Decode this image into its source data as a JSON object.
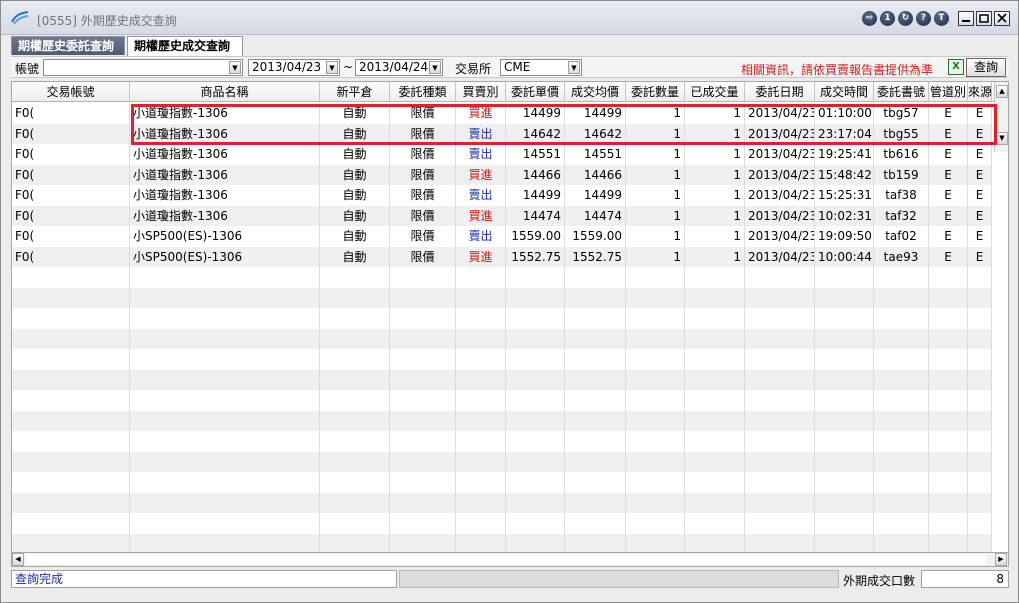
{
  "window": {
    "title": "[0555] 外期歷史成交查詢"
  },
  "titlebar_icons": [
    "export-icon",
    "info-1-icon",
    "refresh-icon",
    "help-icon",
    "t-icon"
  ],
  "tabs": [
    {
      "label": "期權歷史委託查詢",
      "active": false
    },
    {
      "label": "期權歷史成交查詢",
      "active": true
    }
  ],
  "filters": {
    "account_label": "帳號",
    "account_value": "",
    "date_from": "2013/04/23",
    "date_sep": "~",
    "date_to": "2013/04/24",
    "exchange_label": "交易所",
    "exchange_value": "CME",
    "notice": "相關資訊，請依買賣報告書提供為準",
    "excel_icon": "excel-icon",
    "query_label": "查詢"
  },
  "columns": [
    "交易帳號",
    "商品名稱",
    "新平倉",
    "委託種類",
    "買賣別",
    "委託單價",
    "成交均價",
    "委託數量",
    "已成交量",
    "委託日期",
    "成交時間",
    "委託書號",
    "管道別",
    "來源"
  ],
  "rows": [
    [
      "F0(",
      "小道瓊指數-1306",
      "自動",
      "限價",
      "買進",
      "14499",
      "14499",
      "1",
      "1",
      "2013/04/23",
      "01:10:00",
      "tbg57",
      "E",
      "E"
    ],
    [
      "F0(",
      "小道瓊指數-1306",
      "自動",
      "限價",
      "賣出",
      "14642",
      "14642",
      "1",
      "1",
      "2013/04/23",
      "23:17:04",
      "tbg55",
      "E",
      "E"
    ],
    [
      "F0(",
      "小道瓊指數-1306",
      "自動",
      "限價",
      "賣出",
      "14551",
      "14551",
      "1",
      "1",
      "2013/04/23",
      "19:25:41",
      "tb616",
      "E",
      "E"
    ],
    [
      "F0(",
      "小道瓊指數-1306",
      "自動",
      "限價",
      "買進",
      "14466",
      "14466",
      "1",
      "1",
      "2013/04/23",
      "15:48:42",
      "tb159",
      "E",
      "E"
    ],
    [
      "F0(",
      "小道瓊指數-1306",
      "自動",
      "限價",
      "賣出",
      "14499",
      "14499",
      "1",
      "1",
      "2013/04/23",
      "15:25:31",
      "taf38",
      "E",
      "E"
    ],
    [
      "F0(",
      "小道瓊指數-1306",
      "自動",
      "限價",
      "買進",
      "14474",
      "14474",
      "1",
      "1",
      "2013/04/23",
      "10:02:31",
      "taf32",
      "E",
      "E"
    ],
    [
      "F0(",
      "小SP500(ES)-1306",
      "自動",
      "限價",
      "賣出",
      "1559.00",
      "1559.00",
      "1",
      "1",
      "2013/04/23",
      "19:09:50",
      "taf02",
      "E",
      "E"
    ],
    [
      "F0(",
      "小SP500(ES)-1306",
      "自動",
      "限價",
      "買進",
      "1552.75",
      "1552.75",
      "1",
      "1",
      "2013/04/23",
      "10:00:44",
      "tae93",
      "E",
      "E"
    ]
  ],
  "status": {
    "message": "查詢完成",
    "count_label": "外期成交口數",
    "count_value": "8"
  },
  "colors": {
    "buy": "#dd1111",
    "sell": "#1a2fb0",
    "highlight": "#e0202a",
    "notice": "#d42020"
  }
}
